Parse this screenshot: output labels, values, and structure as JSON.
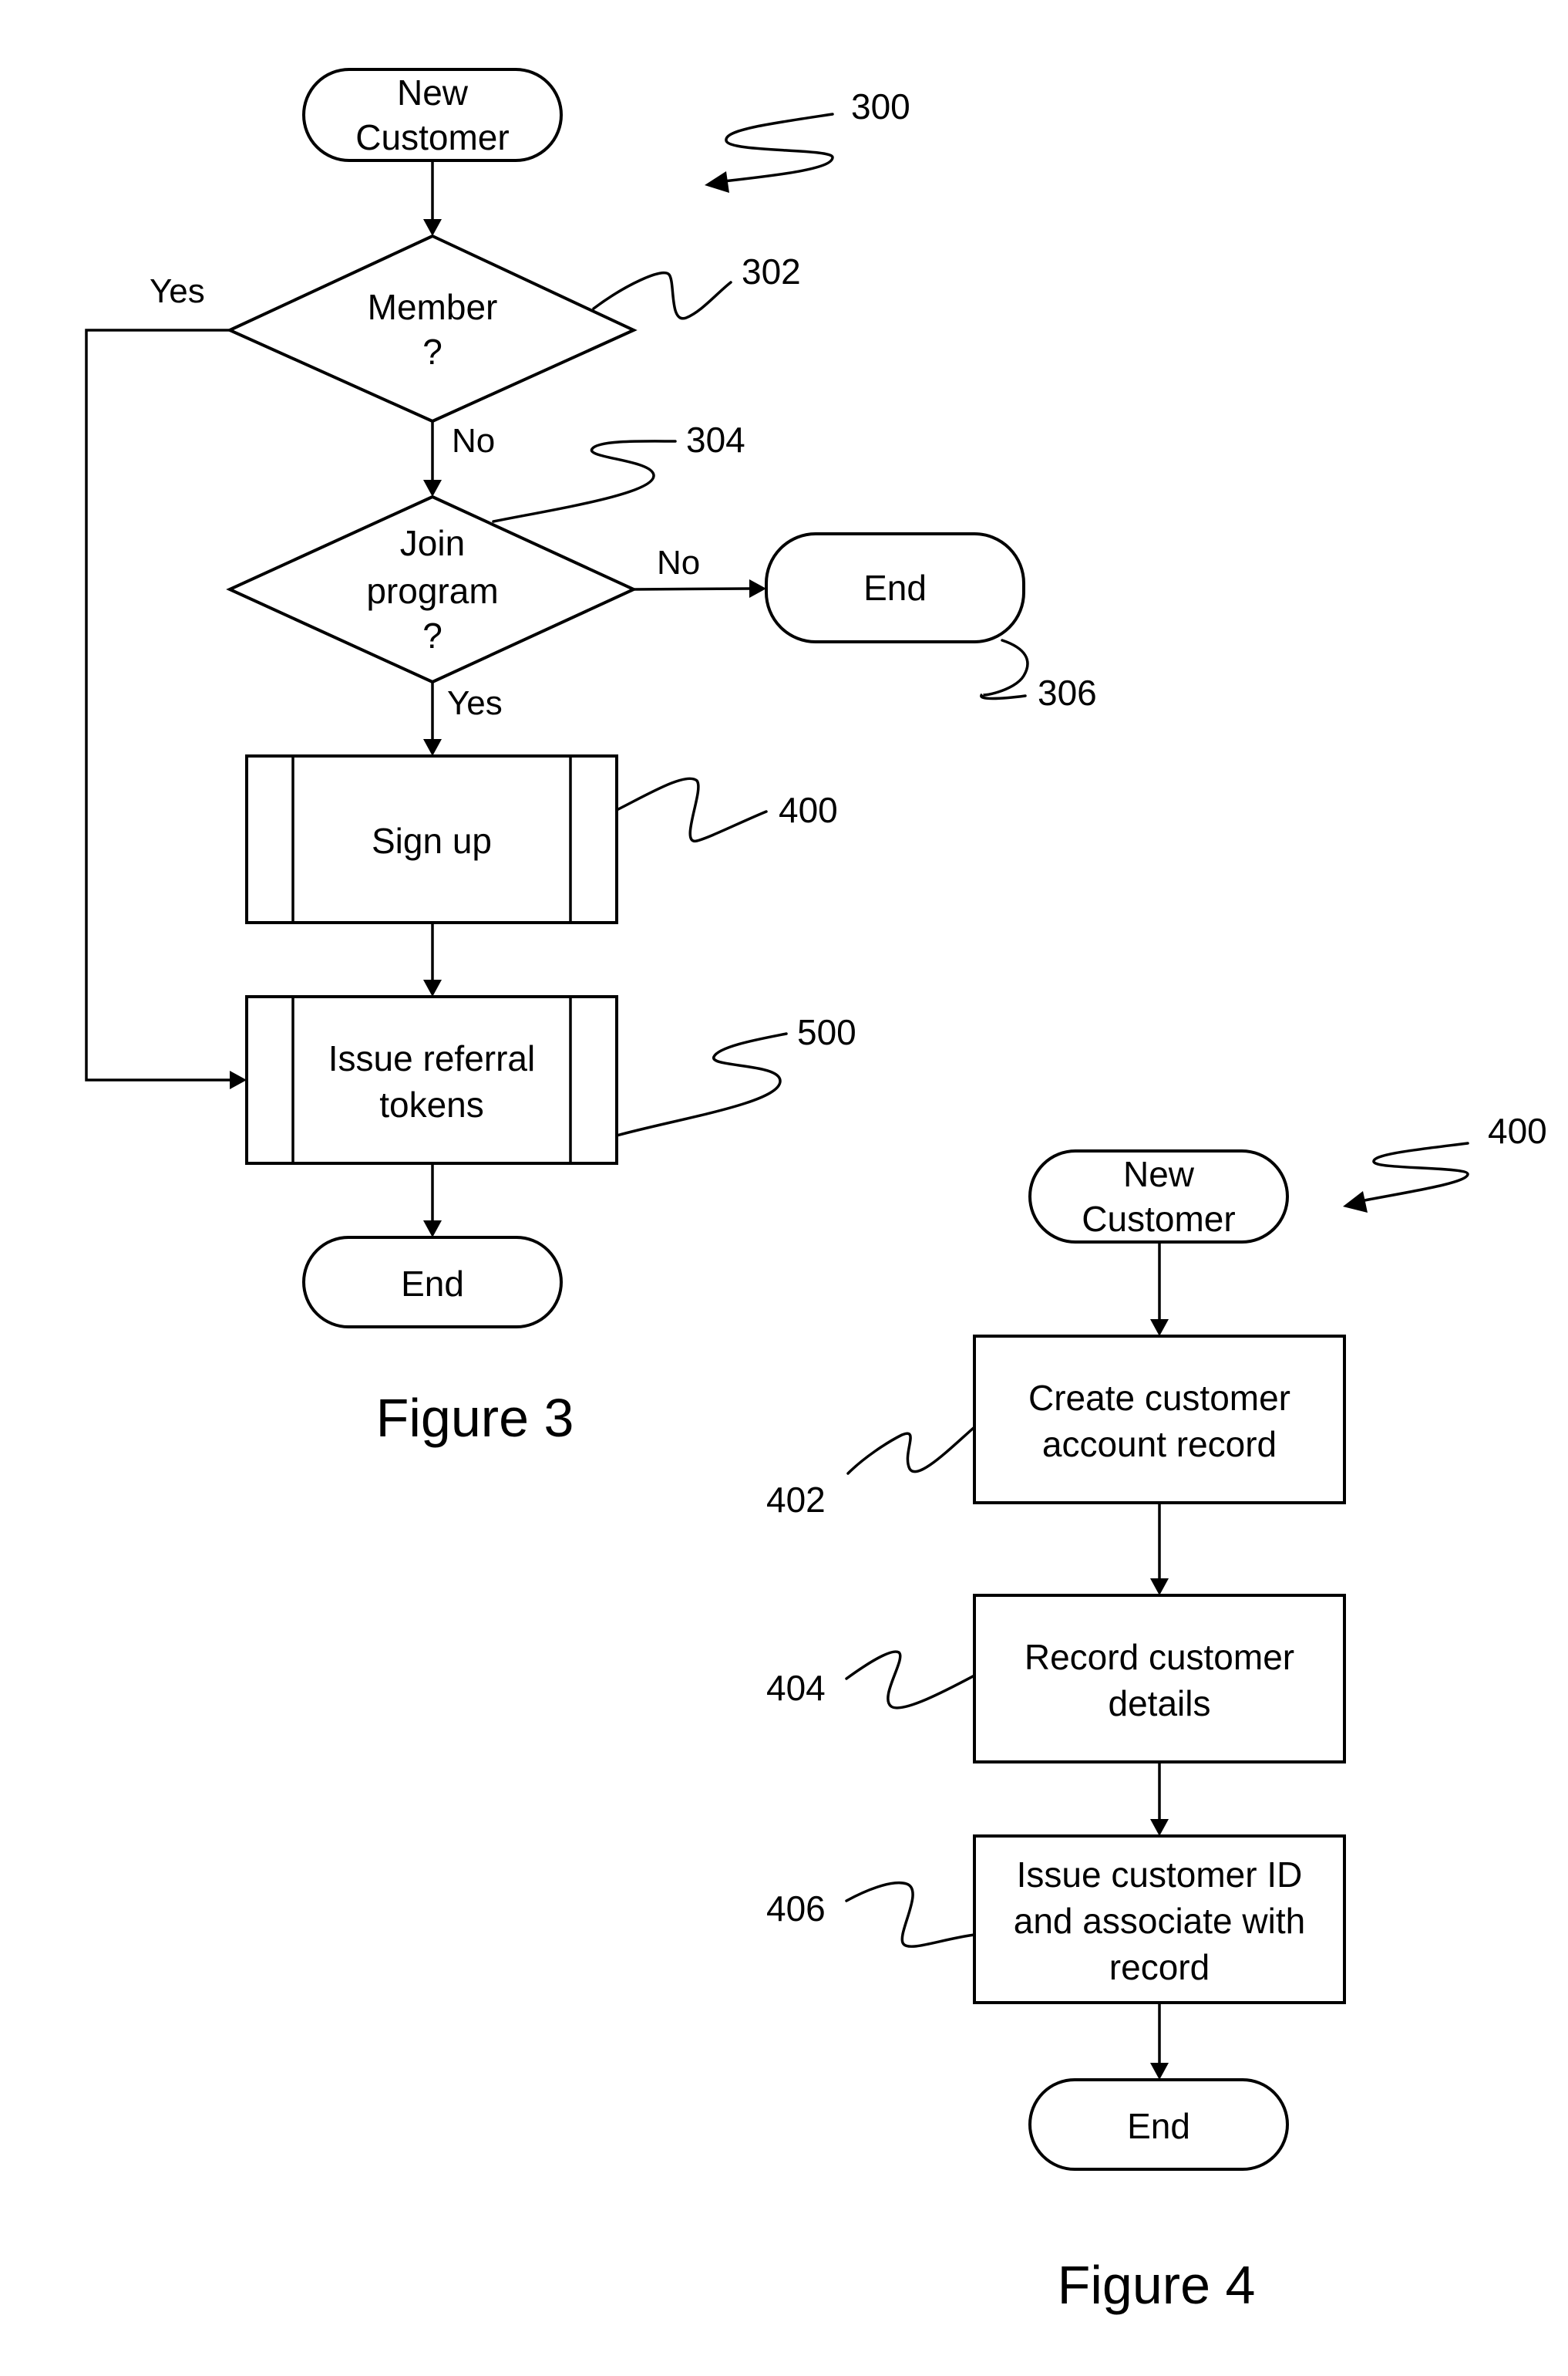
{
  "figure3": {
    "caption": "Figure 3",
    "ref_number": "300",
    "start": {
      "lines": [
        "New",
        "Customer"
      ]
    },
    "decision_member": {
      "lines": [
        "Member",
        "?"
      ],
      "ref": "302",
      "yes_label": "Yes",
      "no_label": "No"
    },
    "decision_join": {
      "lines": [
        "Join",
        "program",
        "?"
      ],
      "ref": "304",
      "yes_label": "Yes",
      "no_label": "No"
    },
    "end_no": {
      "label": "End",
      "ref": "306"
    },
    "sign_up": {
      "label": "Sign up",
      "ref": "400"
    },
    "issue_tokens": {
      "lines": [
        "Issue referral",
        "tokens"
      ],
      "ref": "500"
    },
    "end": {
      "label": "End"
    }
  },
  "figure4": {
    "caption": "Figure 4",
    "ref_number": "400",
    "start": {
      "lines": [
        "New",
        "Customer"
      ]
    },
    "steps": [
      {
        "lines": [
          "Create customer",
          "account record"
        ],
        "ref": "402"
      },
      {
        "lines": [
          "Record customer",
          "details"
        ],
        "ref": "404"
      },
      {
        "lines": [
          "Issue customer ID",
          "and associate with",
          "record"
        ],
        "ref": "406"
      }
    ],
    "end": {
      "label": "End"
    }
  }
}
